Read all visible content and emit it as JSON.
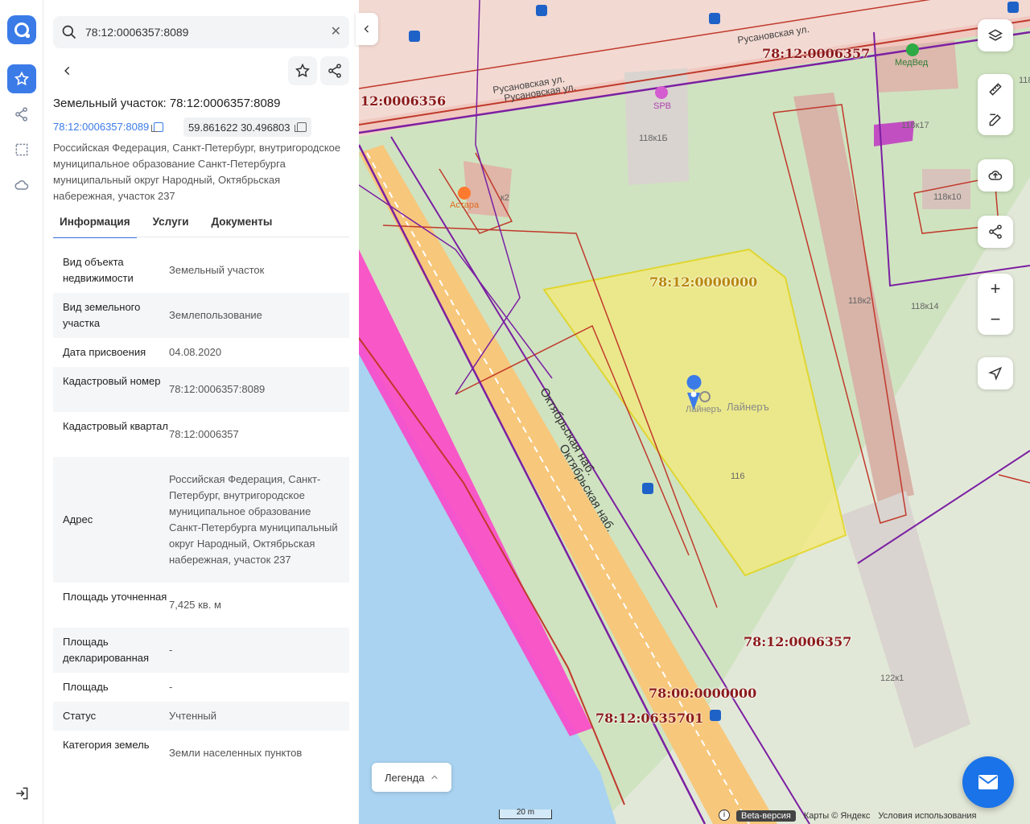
{
  "search": {
    "value": "78:12:0006357:8089"
  },
  "object": {
    "title": "Земельный участок: 78:12:0006357:8089",
    "cadastral_link": "78:12:0006357:8089",
    "coords": "59.861622 30.496803",
    "address": "Российская Федерация, Санкт-Петербург, внутригородское муниципальное образование Санкт-Петербурга муниципальный округ Народный, Октябрьская набережная, участок 237"
  },
  "tabs": [
    {
      "label": "Информация",
      "active": true
    },
    {
      "label": "Услуги",
      "active": false
    },
    {
      "label": "Документы",
      "active": false
    }
  ],
  "info_rows": [
    {
      "key": "Вид объекта недвижимости",
      "value": "Земельный участок"
    },
    {
      "key": "Вид земельного участка",
      "value": "Землепользование"
    },
    {
      "key": "Дата присвоения",
      "value": "04.08.2020"
    },
    {
      "key": "Кадастровый номер",
      "value": "78:12:0006357:8089"
    },
    {
      "key": "Кадастровый квартал",
      "value": "78:12:0006357"
    },
    {
      "key": "Адрес",
      "value": "Российская Федерация, Санкт-Петербург, внутригородское муниципальное образование Санкт-Петербурга муниципальный округ Народный, Октябрьская набережная, участок 237"
    },
    {
      "key": "Площадь уточненная",
      "value": "7,425 кв. м"
    },
    {
      "key": "Площадь декларированная",
      "value": "-"
    },
    {
      "key": "Площадь",
      "value": "-"
    },
    {
      "key": "Статус",
      "value": "Учтенный"
    },
    {
      "key": "Категория земель",
      "value": "Земли населенных пунктов"
    }
  ],
  "map": {
    "labels": {
      "q6357_top": "78:12:0006357",
      "q6356": "12:0006356",
      "q0000000": "78:12:0000000",
      "q6357_bottom": "78:12:0006357",
      "q00_0000000": "78:00:0000000",
      "q0635701": "78:12:0635701"
    },
    "streets": {
      "rusanovskaya1": "Русановская ул.",
      "rusanovskaya2": "Русановская ул.",
      "rusanovskaya3": "Русановская ул.",
      "oktyabrskaya1": "Октябрьская наб.",
      "oktyabrskaya2": "Октябрьская наб."
    },
    "pois": {
      "medved": "МедВед",
      "spb": "SPB",
      "astara": "Астара",
      "liner1": "Лайнеръ",
      "liner2": "Лайнеръ"
    },
    "buildings": {
      "b118k1b": "118к1Б",
      "b118k17": "118к17",
      "b118k10": "118к10",
      "b118k2": "118к2",
      "b118k14": "118к14",
      "b116": "116",
      "b122k1": "122к1",
      "bk2": "к2",
      "b118": "118"
    },
    "legend_label": "Легенда",
    "scale_label": "20 m",
    "footer": {
      "beta": "Beta-версия",
      "copyright": "Карты © Яндекс",
      "terms": "Условия использования"
    }
  },
  "colors": {
    "accent": "#3b7be8",
    "selected_parcel": "#f5ea7a",
    "parcel_border": "#c0392b",
    "quarter_border": "#7b1fa2",
    "water": "#a9d3f0",
    "road": "#f7c77b",
    "highlight_zone": "#ff3ec8"
  }
}
